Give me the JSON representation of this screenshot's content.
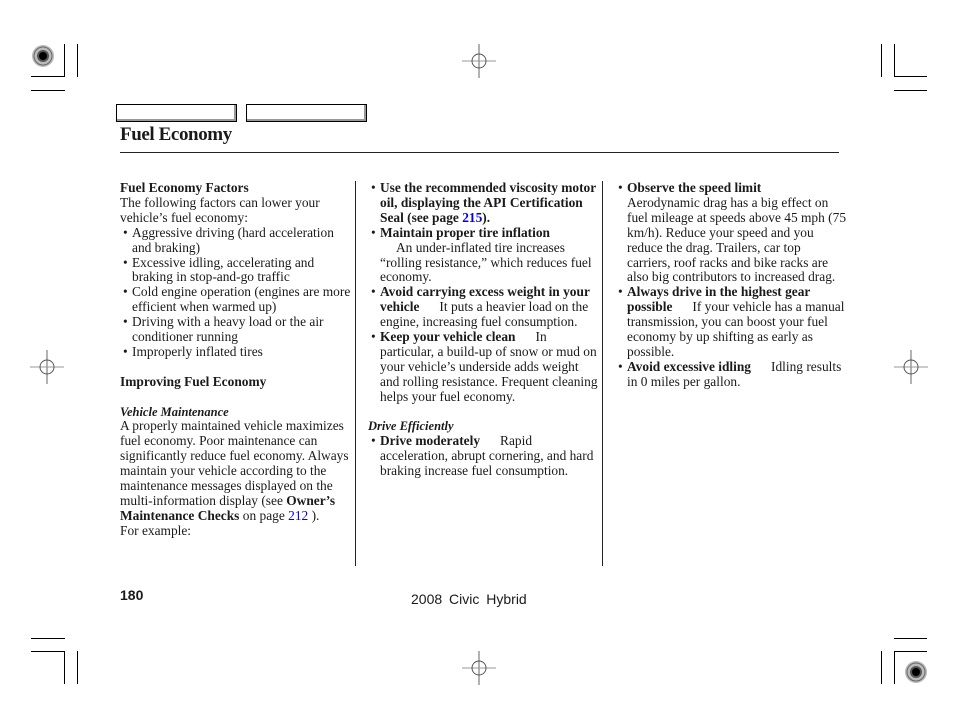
{
  "header": {
    "nav_buttons": [
      "",
      ""
    ],
    "title": "Fuel Economy"
  },
  "column1": {
    "factors_heading": "Fuel Economy Factors",
    "factors_intro": "The following factors can lower your vehicle’s fuel economy:",
    "factors": [
      "Aggressive driving (hard acceleration and braking)",
      "Excessive idling, accelerating and braking in stop-and-go traffic",
      "Cold engine operation (engines are more efficient when warmed up)",
      "Driving with a heavy load or the air conditioner running",
      "Improperly inflated tires"
    ],
    "improving_heading": "Improving Fuel Economy",
    "maintenance_subheading": "Vehicle Maintenance",
    "maintenance_text_1": "A properly maintained vehicle maximizes fuel economy. Poor maintenance can significantly reduce fuel economy. Always maintain your vehicle according to the maintenance messages displayed on the multi-information display (see ",
    "maintenance_bold": "Owner’s Maintenance Checks",
    "maintenance_text_2": " on page ",
    "maintenance_link": "212",
    "maintenance_text_3": " ).",
    "maintenance_text_4": "For example:"
  },
  "column2": {
    "tips": [
      {
        "bold": "Use the recommended viscosity motor oil, displaying the API Certification Seal (see page ",
        "link": "215",
        "bold_end": ").",
        "text": ""
      },
      {
        "bold": "Maintain proper tire inflation",
        "text": "An under-inflated tire increases “rolling resistance,” which reduces fuel economy."
      },
      {
        "bold": "Avoid carrying excess weight in your vehicle",
        "text": "It puts a heavier load on the engine, increasing fuel consumption."
      },
      {
        "bold": "Keep your vehicle clean",
        "text": "In particular, a build-up of snow or mud on your vehicle’s underside adds weight and rolling resistance. Frequent cleaning helps your fuel economy."
      }
    ],
    "drive_subheading": "Drive Efficiently",
    "drive_tips": [
      {
        "bold": "Drive moderately",
        "text": "Rapid acceleration, abrupt cornering, and hard braking increase fuel consumption."
      }
    ]
  },
  "column3": {
    "tips": [
      {
        "bold": "Observe the speed limit",
        "text": "Aerodynamic drag has a big effect on fuel mileage at speeds above 45 mph (75 km/h). Reduce your speed and you reduce the drag. Trailers, car top carriers, roof racks and bike racks are also big contributors to increased drag."
      },
      {
        "bold": "Always drive in the highest gear possible",
        "text": "If your vehicle has a manual transmission, you can boost your fuel economy by up shifting as early as possible."
      },
      {
        "bold": "Avoid excessive idling",
        "text": "Idling results in 0 miles per gallon."
      }
    ]
  },
  "footer": {
    "page_number": "180",
    "book_title": "2008  Civic  Hybrid"
  },
  "colors": {
    "link": "#0000ee",
    "text": "#1a1a1a"
  }
}
